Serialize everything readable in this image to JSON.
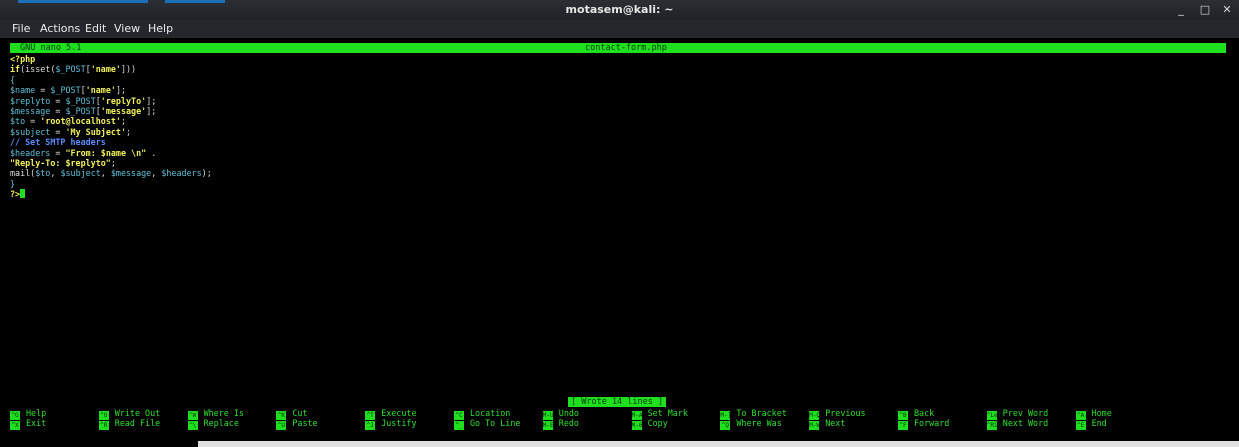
{
  "window": {
    "title": "motasem@kali: ~"
  },
  "menu": [
    "File",
    "Actions",
    "Edit",
    "View",
    "Help"
  ],
  "nano": {
    "version": "GNU nano 5.1",
    "filename": "contact-form.php"
  },
  "code": [
    [
      {
        "t": "<?php",
        "c": "kw"
      }
    ],
    [
      {
        "t": "if",
        "c": "kw"
      },
      {
        "t": "(isset(",
        "c": "def"
      },
      {
        "t": "$_POST",
        "c": "var"
      },
      {
        "t": "[",
        "c": "def"
      },
      {
        "t": "'name'",
        "c": "str"
      },
      {
        "t": "]))",
        "c": "def"
      }
    ],
    [
      {
        "t": "{",
        "c": "var"
      }
    ],
    [
      {
        "t": "$name",
        "c": "var"
      },
      {
        "t": " = ",
        "c": "def"
      },
      {
        "t": "$_POST",
        "c": "var"
      },
      {
        "t": "[",
        "c": "def"
      },
      {
        "t": "'name'",
        "c": "str"
      },
      {
        "t": "];",
        "c": "def"
      }
    ],
    [
      {
        "t": "$replyto",
        "c": "var"
      },
      {
        "t": " = ",
        "c": "def"
      },
      {
        "t": "$_POST",
        "c": "var"
      },
      {
        "t": "[",
        "c": "def"
      },
      {
        "t": "'replyTo'",
        "c": "str"
      },
      {
        "t": "];",
        "c": "def"
      }
    ],
    [
      {
        "t": "$message",
        "c": "var"
      },
      {
        "t": " = ",
        "c": "def"
      },
      {
        "t": "$_POST",
        "c": "var"
      },
      {
        "t": "[",
        "c": "def"
      },
      {
        "t": "'message'",
        "c": "str"
      },
      {
        "t": "];",
        "c": "def"
      }
    ],
    [
      {
        "t": "$to",
        "c": "var"
      },
      {
        "t": " = ",
        "c": "def"
      },
      {
        "t": "'root@localhost'",
        "c": "str"
      },
      {
        "t": ";",
        "c": "def"
      }
    ],
    [
      {
        "t": "$subject",
        "c": "var"
      },
      {
        "t": " = ",
        "c": "def"
      },
      {
        "t": "'My Subject'",
        "c": "str"
      },
      {
        "t": ";",
        "c": "def"
      }
    ],
    [
      {
        "t": "// Set SMTP headers",
        "c": "cm"
      }
    ],
    [
      {
        "t": "$headers",
        "c": "var"
      },
      {
        "t": " = ",
        "c": "def"
      },
      {
        "t": "\"From: $name \\n\"",
        "c": "str"
      },
      {
        "t": " .",
        "c": "def"
      }
    ],
    [
      {
        "t": "\"Reply-To: $replyto\"",
        "c": "str"
      },
      {
        "t": ";",
        "c": "def"
      }
    ],
    [
      {
        "t": "mail(",
        "c": "def"
      },
      {
        "t": "$to",
        "c": "var"
      },
      {
        "t": ", ",
        "c": "def"
      },
      {
        "t": "$subject",
        "c": "var"
      },
      {
        "t": ", ",
        "c": "def"
      },
      {
        "t": "$message",
        "c": "var"
      },
      {
        "t": ", ",
        "c": "def"
      },
      {
        "t": "$headers",
        "c": "var"
      },
      {
        "t": ");",
        "c": "def"
      }
    ],
    [
      {
        "t": "}",
        "c": "var"
      }
    ],
    [
      {
        "t": "?>",
        "c": "kw"
      }
    ]
  ],
  "status": "[ Wrote 14 lines ]",
  "shortcuts": [
    [
      {
        "key": "^G",
        "label": "Help"
      },
      {
        "key": "^X",
        "label": "Exit"
      }
    ],
    [
      {
        "key": "^O",
        "label": "Write Out"
      },
      {
        "key": "^R",
        "label": "Read File"
      }
    ],
    [
      {
        "key": "^W",
        "label": "Where Is"
      },
      {
        "key": "^\\",
        "label": "Replace"
      }
    ],
    [
      {
        "key": "^K",
        "label": "Cut"
      },
      {
        "key": "^U",
        "label": "Paste"
      }
    ],
    [
      {
        "key": "^T",
        "label": "Execute"
      },
      {
        "key": "^J",
        "label": "Justify"
      }
    ],
    [
      {
        "key": "^C",
        "label": "Location"
      },
      {
        "key": "^_",
        "label": "Go To Line"
      }
    ],
    [
      {
        "key": "M-U",
        "label": "Undo"
      },
      {
        "key": "M-E",
        "label": "Redo"
      }
    ],
    [
      {
        "key": "M-A",
        "label": "Set Mark"
      },
      {
        "key": "M-6",
        "label": "Copy"
      }
    ],
    [
      {
        "key": "M-]",
        "label": "To Bracket"
      },
      {
        "key": "^Q",
        "label": "Where Was"
      }
    ],
    [
      {
        "key": "M-Q",
        "label": "Previous"
      },
      {
        "key": "M-W",
        "label": "Next"
      }
    ],
    [
      {
        "key": "^B",
        "label": "Back"
      },
      {
        "key": "^F",
        "label": "Forward"
      }
    ],
    [
      {
        "key": "^Left",
        "label": "Prev Word"
      },
      {
        "key": "^Right",
        "label": "Next Word"
      }
    ],
    [
      {
        "key": "^A",
        "label": "Home"
      },
      {
        "key": "^E",
        "label": "End"
      }
    ]
  ]
}
